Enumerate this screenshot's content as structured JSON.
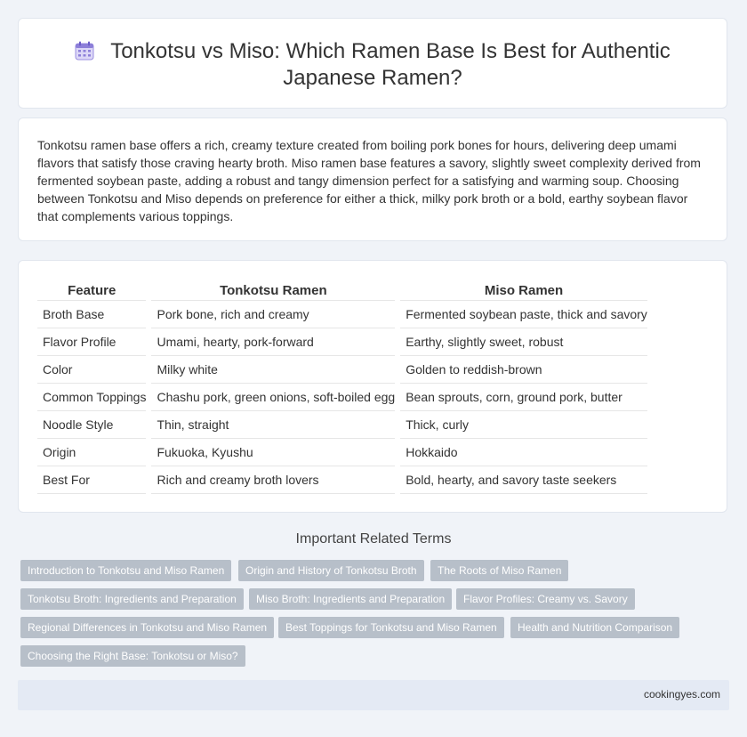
{
  "header": {
    "title": "Tonkotsu vs Miso: Which Ramen Base Is Best for Authentic Japanese Ramen?"
  },
  "intro": {
    "text": "Tonkotsu ramen base offers a rich, creamy texture created from boiling pork bones for hours, delivering deep umami flavors that satisfy those craving hearty broth. Miso ramen base features a savory, slightly sweet complexity derived from fermented soybean paste, adding a robust and tangy dimension perfect for a satisfying and warming soup. Choosing between Tonkotsu and Miso depends on preference for either a thick, milky pork broth or a bold, earthy soybean flavor that complements various toppings."
  },
  "table": {
    "headers": [
      "Feature",
      "Tonkotsu Ramen",
      "Miso Ramen"
    ],
    "rows": [
      [
        "Broth Base",
        "Pork bone, rich and creamy",
        "Fermented soybean paste, thick and savory"
      ],
      [
        "Flavor Profile",
        "Umami, hearty, pork-forward",
        "Earthy, slightly sweet, robust"
      ],
      [
        "Color",
        "Milky white",
        "Golden to reddish-brown"
      ],
      [
        "Common Toppings",
        "Chashu pork, green onions, soft-boiled egg",
        "Bean sprouts, corn, ground pork, butter"
      ],
      [
        "Noodle Style",
        "Thin, straight",
        "Thick, curly"
      ],
      [
        "Origin",
        "Fukuoka, Kyushu",
        "Hokkaido"
      ],
      [
        "Best For",
        "Rich and creamy broth lovers",
        "Bold, hearty, and savory taste seekers"
      ]
    ]
  },
  "related": {
    "title": "Important Related Terms",
    "tags": [
      "Introduction to Tonkotsu and Miso Ramen",
      "Origin and History of Tonkotsu Broth",
      "The Roots of Miso Ramen",
      "Tonkotsu Broth: Ingredients and Preparation",
      "Miso Broth: Ingredients and Preparation",
      "Flavor Profiles: Creamy vs. Savory",
      "Regional Differences in Tonkotsu and Miso Ramen",
      "Best Toppings for Tonkotsu and Miso Ramen",
      "Health and Nutrition Comparison",
      "Choosing the Right Base: Tonkotsu or Miso?"
    ]
  },
  "footer": {
    "site": "cookingyes.com"
  },
  "icons": {
    "title_icon": "calendar-icon"
  },
  "colors": {
    "background": "#f0f3f8",
    "tag_background": "#b7bfc9",
    "icon_accent": "#8d7fd9"
  }
}
